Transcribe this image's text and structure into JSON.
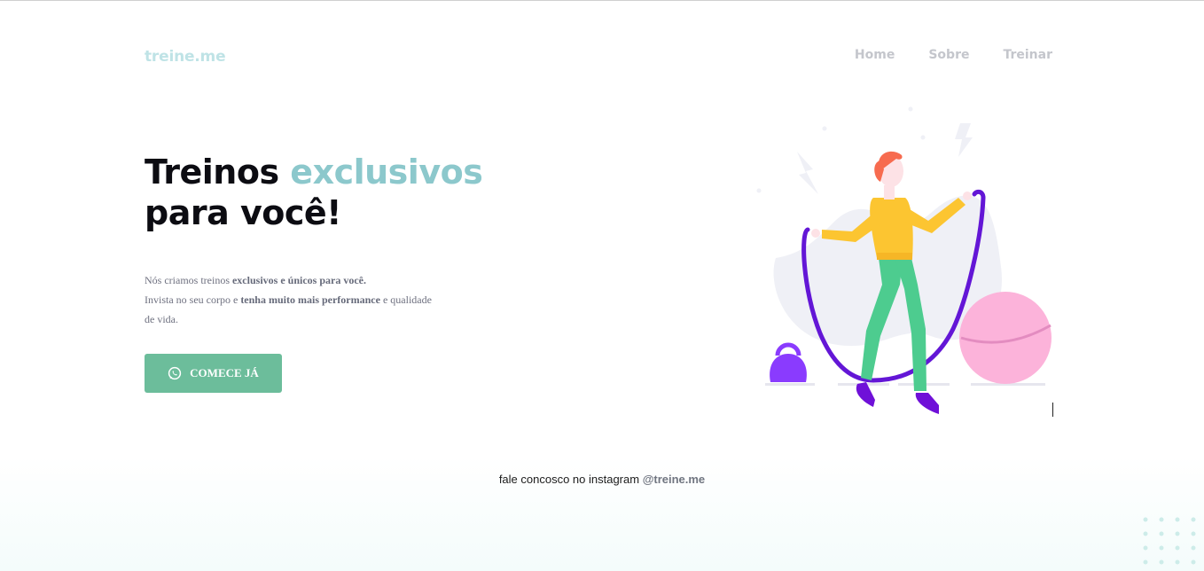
{
  "header": {
    "logo": "treine.me",
    "nav": [
      "Home",
      "Sobre",
      "Treinar"
    ]
  },
  "hero": {
    "title_word1": "Treinos",
    "title_accent": "exclusivos",
    "title_line2": "para você!",
    "p1_a": "Nós criamos treinos ",
    "p1_b": "exclusivos e únicos para você.",
    "p2_a": "Invista no seu corpo e ",
    "p2_b": "tenha muito mais performance",
    "p2_c": " e qualidade de vida.",
    "cta_label": "COMECE JÁ",
    "cta_icon": "whatsapp-icon",
    "illustration": "woman-jumping-rope-illustration"
  },
  "footer": {
    "text": "fale concosco no instagram ",
    "handle": "@treine.me"
  },
  "colors": {
    "logo": "#bfe3e6",
    "accent": "#8cc8cc",
    "cta": "#6cbd9b",
    "nav": "#c4c6cc"
  }
}
